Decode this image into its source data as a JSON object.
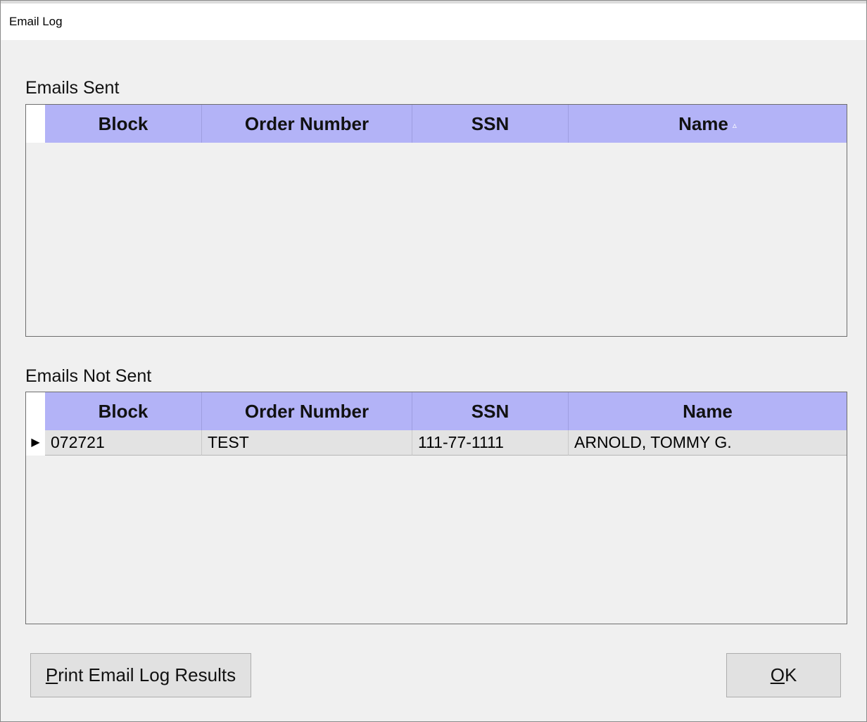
{
  "window": {
    "title": "Email Log"
  },
  "sent": {
    "label": "Emails Sent",
    "columns": [
      "Block",
      "Order Number",
      "SSN",
      "Name"
    ],
    "sort_indicator": "▵",
    "rows": []
  },
  "not_sent": {
    "label": "Emails Not Sent",
    "columns": [
      "Block",
      "Order Number",
      "SSN",
      "Name"
    ],
    "row_indicator": "▶",
    "rows": [
      {
        "block": "072721",
        "order_number": "TEST",
        "ssn": "111-77-1111",
        "name": "ARNOLD, TOMMY G."
      }
    ]
  },
  "buttons": {
    "print": {
      "mnemonic": "P",
      "rest": "rint Email Log Results"
    },
    "ok": {
      "mnemonic": "O",
      "rest": "K"
    }
  },
  "colors": {
    "header_bg": "#b3b3f7",
    "row_bg": "#e3e3e3",
    "window_bg": "#f0f0f0"
  }
}
